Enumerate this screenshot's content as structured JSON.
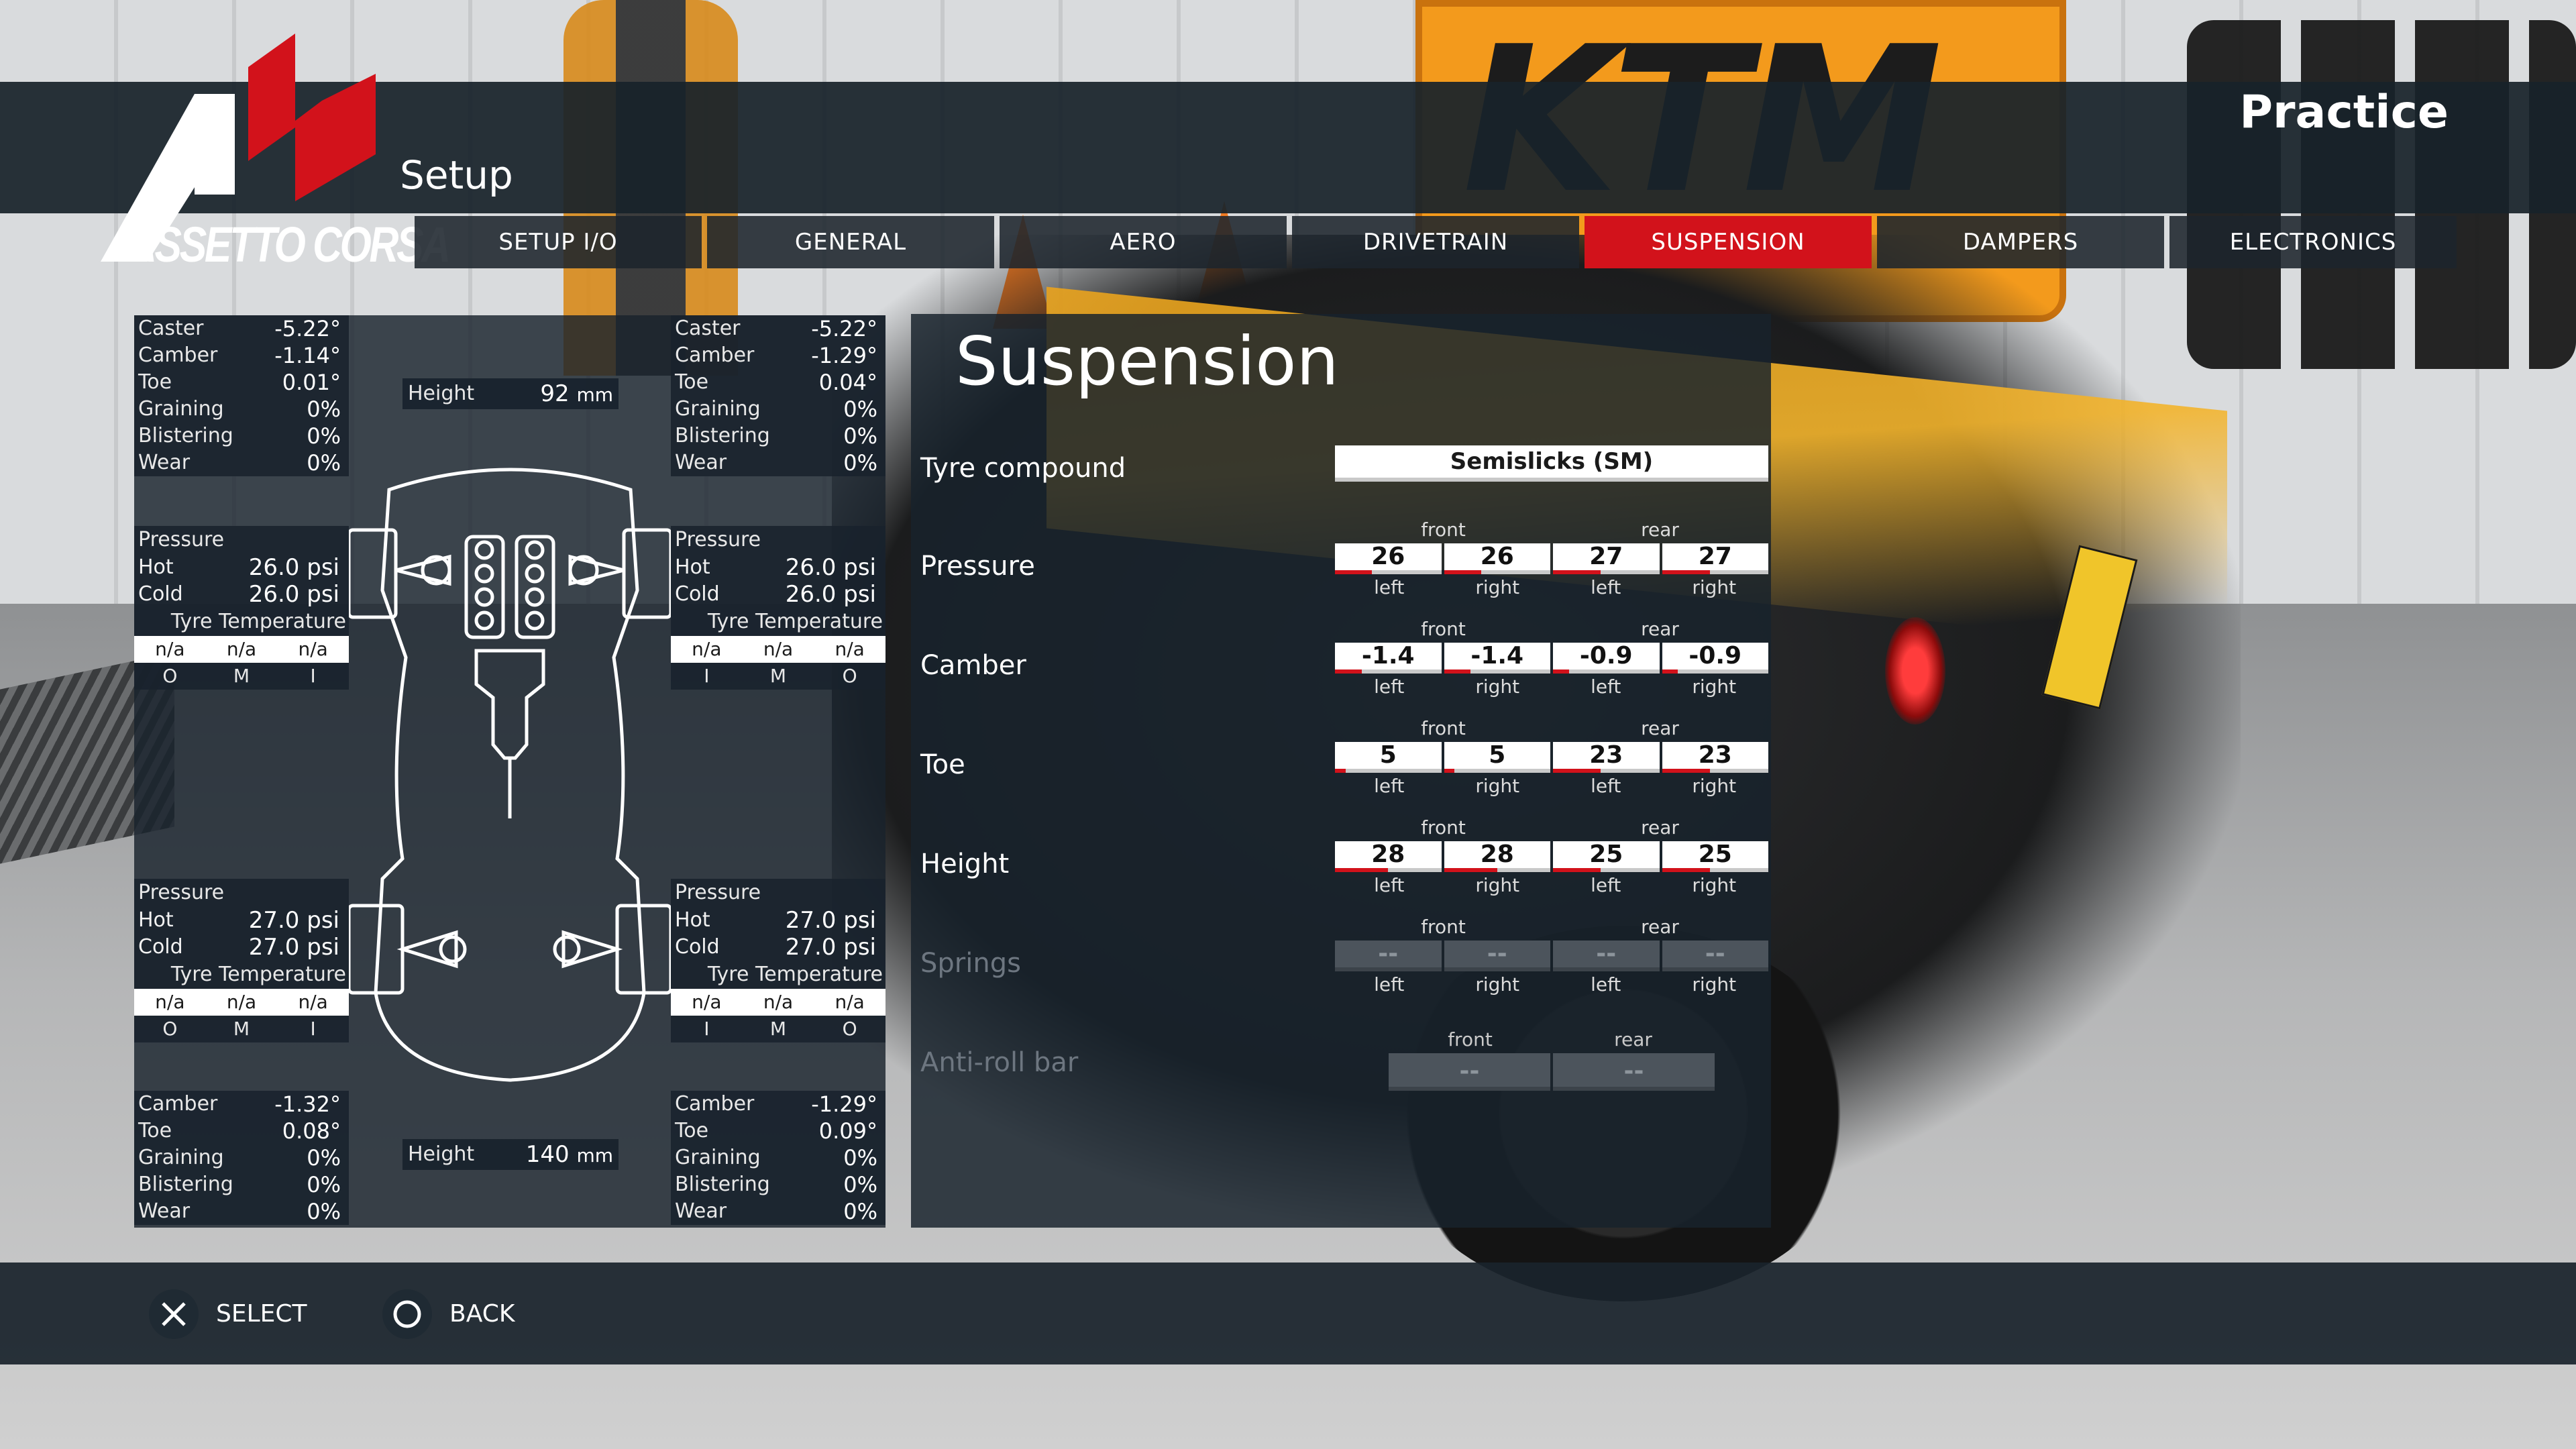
{
  "header": {
    "logo_text": "ASSETTO CORSA",
    "screen_title": "Setup",
    "session": "Practice"
  },
  "tabs": [
    {
      "label": "SETUP I/O",
      "active": false
    },
    {
      "label": "GENERAL",
      "active": false
    },
    {
      "label": "AERO",
      "active": false
    },
    {
      "label": "DRIVETRAIN",
      "active": false
    },
    {
      "label": "SUSPENSION",
      "active": true
    },
    {
      "label": "DAMPERS",
      "active": false
    },
    {
      "label": "ELECTRONICS",
      "active": false
    }
  ],
  "telemetry": {
    "front_height": {
      "label": "Height",
      "value": "92",
      "unit": "mm"
    },
    "rear_height": {
      "label": "Height",
      "value": "140",
      "unit": "mm"
    },
    "labels": {
      "caster": "Caster",
      "camber": "Camber",
      "toe": "Toe",
      "graining": "Graining",
      "blistering": "Blistering",
      "wear": "Wear",
      "pressure": "Pressure",
      "hot": "Hot",
      "cold": "Cold",
      "tyre_temperature": "Tyre Temperature"
    },
    "front_left": {
      "caster": "-5.22°",
      "camber": "-1.14°",
      "toe": "0.01°",
      "graining": "0%",
      "blistering": "0%",
      "wear": "0%",
      "hot": "26.0 psi",
      "cold": "26.0 psi",
      "temps": [
        "n/a",
        "n/a",
        "n/a"
      ],
      "temp_zones": [
        "O",
        "M",
        "I"
      ]
    },
    "front_right": {
      "caster": "-5.22°",
      "camber": "-1.29°",
      "toe": "0.04°",
      "graining": "0%",
      "blistering": "0%",
      "wear": "0%",
      "hot": "26.0 psi",
      "cold": "26.0 psi",
      "temps": [
        "n/a",
        "n/a",
        "n/a"
      ],
      "temp_zones": [
        "I",
        "M",
        "O"
      ]
    },
    "rear_left": {
      "camber": "-1.32°",
      "toe": "0.08°",
      "graining": "0%",
      "blistering": "0%",
      "wear": "0%",
      "hot": "27.0 psi",
      "cold": "27.0 psi",
      "temps": [
        "n/a",
        "n/a",
        "n/a"
      ],
      "temp_zones": [
        "O",
        "M",
        "I"
      ]
    },
    "rear_right": {
      "camber": "-1.29°",
      "toe": "0.09°",
      "graining": "0%",
      "blistering": "0%",
      "wear": "0%",
      "hot": "27.0 psi",
      "cold": "27.0 psi",
      "temps": [
        "n/a",
        "n/a",
        "n/a"
      ],
      "temp_zones": [
        "I",
        "M",
        "O"
      ]
    }
  },
  "suspension": {
    "title": "Suspension",
    "tyre_compound": {
      "label": "Tyre compound",
      "value": "Semislicks (SM)"
    },
    "axle_labels": {
      "front": "front",
      "rear": "rear"
    },
    "side_labels": {
      "left": "left",
      "right": "right"
    },
    "rows": [
      {
        "label": "Pressure",
        "values": [
          "26",
          "26",
          "27",
          "27"
        ],
        "levels": [
          0.35,
          0.35,
          0.45,
          0.45
        ],
        "enabled": true
      },
      {
        "label": "Camber",
        "values": [
          "-1.4",
          "-1.4",
          "-0.9",
          "-0.9"
        ],
        "levels": [
          0.25,
          0.25,
          0.15,
          0.15
        ],
        "enabled": true
      },
      {
        "label": "Toe",
        "values": [
          "5",
          "5",
          "23",
          "23"
        ],
        "levels": [
          0.1,
          0.1,
          0.45,
          0.45
        ],
        "enabled": true
      },
      {
        "label": "Height",
        "values": [
          "28",
          "28",
          "25",
          "25"
        ],
        "levels": [
          0.5,
          0.5,
          0.45,
          0.45
        ],
        "enabled": true
      },
      {
        "label": "Springs",
        "values": [
          "--",
          "--",
          "--",
          "--"
        ],
        "levels": [
          0,
          0,
          0,
          0
        ],
        "enabled": false
      }
    ],
    "anti_roll_bar": {
      "label": "Anti-roll bar",
      "front": "--",
      "rear": "--",
      "enabled": false
    }
  },
  "footer": {
    "select": {
      "icon": "cross-button-icon",
      "label": "SELECT"
    },
    "back": {
      "icon": "circle-button-icon",
      "label": "BACK"
    }
  },
  "colors": {
    "accent": "#d2121b",
    "panel": "#18222c"
  }
}
